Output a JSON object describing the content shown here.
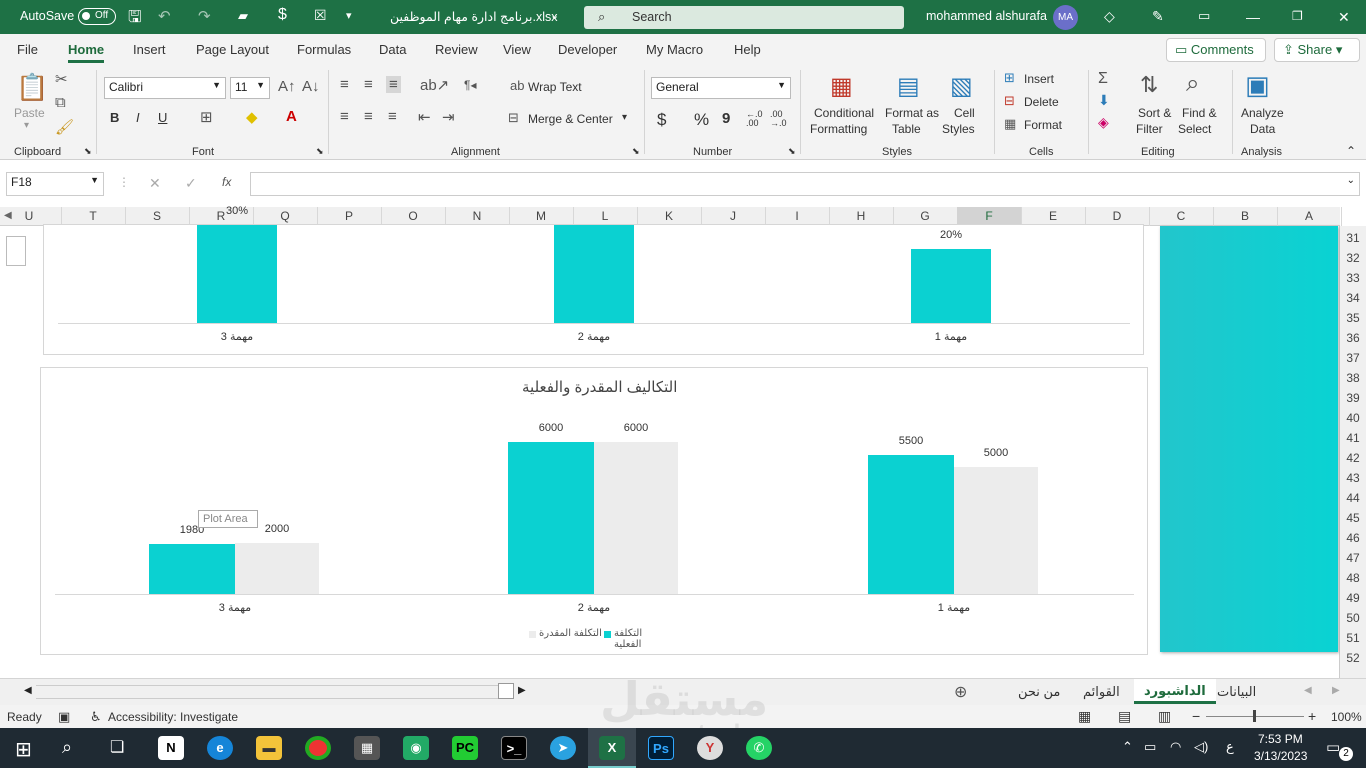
{
  "titlebar": {
    "autosave_label": "AutoSave",
    "autosave_state": "Off",
    "filename": "برنامج ادارة مهام الموظفين.xlsx",
    "search_placeholder": "Search",
    "user_name": "mohammed alshurafa",
    "user_initials": "MA"
  },
  "menu": {
    "items": [
      "File",
      "Home",
      "Insert",
      "Page Layout",
      "Formulas",
      "Data",
      "Review",
      "View",
      "Developer",
      "My Macro",
      "Help"
    ],
    "active": "Home",
    "comments": "Comments",
    "share": "Share"
  },
  "ribbon": {
    "clipboard": {
      "group": "Clipboard",
      "paste": "Paste"
    },
    "font": {
      "group": "Font",
      "name": "Calibri",
      "size": "11",
      "bold": "B",
      "italic": "I",
      "underline": "U"
    },
    "alignment": {
      "group": "Alignment",
      "wrap": "Wrap Text",
      "merge": "Merge & Center"
    },
    "number": {
      "group": "Number",
      "format": "General",
      "currency": "$",
      "percent": "%",
      "comma": "9",
      "inc_dec": "←.0 .00",
      "dec_dec": ".00 →.0"
    },
    "styles": {
      "group": "Styles",
      "conditional_1": "Conditional",
      "conditional_2": "Formatting",
      "format_table_1": "Format as",
      "format_table_2": "Table",
      "cell_styles_1": "Cell",
      "cell_styles_2": "Styles"
    },
    "cells": {
      "group": "Cells",
      "insert": "Insert",
      "delete": "Delete",
      "format": "Format"
    },
    "editing": {
      "group": "Editing",
      "sort_1": "Sort &",
      "sort_2": "Filter",
      "find_1": "Find &",
      "find_2": "Select"
    },
    "analysis": {
      "group": "Analysis",
      "analyze_1": "Analyze",
      "analyze_2": "Data"
    }
  },
  "formula_bar": {
    "name_box": "F18",
    "value": ""
  },
  "columns": [
    "U",
    "T",
    "S",
    "R",
    "Q",
    "P",
    "O",
    "N",
    "M",
    "L",
    "K",
    "J",
    "I",
    "H",
    "G",
    "F",
    "E",
    "D",
    "C",
    "B",
    "A"
  ],
  "rows": [
    "31",
    "32",
    "33",
    "34",
    "35",
    "36",
    "37",
    "38",
    "39",
    "40",
    "41",
    "42",
    "43",
    "44",
    "45",
    "46",
    "47",
    "48",
    "49",
    "50",
    "51",
    "52"
  ],
  "chart_data": [
    {
      "type": "bar",
      "title": "",
      "categories": [
        "مهمة 1",
        "مهمة 2",
        "مهمة 3"
      ],
      "series": [
        {
          "values": [
            20,
            null,
            30
          ]
        }
      ],
      "data_labels": [
        "20%",
        "",
        "30%"
      ],
      "colors": [
        "#0bd1d1"
      ]
    },
    {
      "type": "bar",
      "title": "التكاليف المقدرة والفعلية",
      "categories": [
        "مهمة 1",
        "مهمة 2",
        "مهمة 3"
      ],
      "series": [
        {
          "name": "التكلفة الفعلية",
          "values": [
            5500,
            6000,
            1980
          ]
        },
        {
          "name": "التكلفة المقدرة",
          "values": [
            5000,
            6000,
            2000
          ]
        }
      ],
      "legend": "bottom",
      "colors": [
        "#0bd1d1",
        "#ececec"
      ],
      "tooltip": "Plot Area"
    }
  ],
  "sheet_tabs": {
    "items": [
      "البيانات",
      "الداشبورد",
      "القوائم",
      "من نحن"
    ],
    "active": "الداشبورد"
  },
  "status": {
    "ready": "Ready",
    "accessibility": "Accessibility: Investigate",
    "zoom": "100%"
  },
  "taskbar": {
    "time": "7:53 PM",
    "date": "3/13/2023",
    "lang": "ع",
    "notifications": "2"
  },
  "watermark": "مستقل",
  "watermark_url": "mostaql.com"
}
